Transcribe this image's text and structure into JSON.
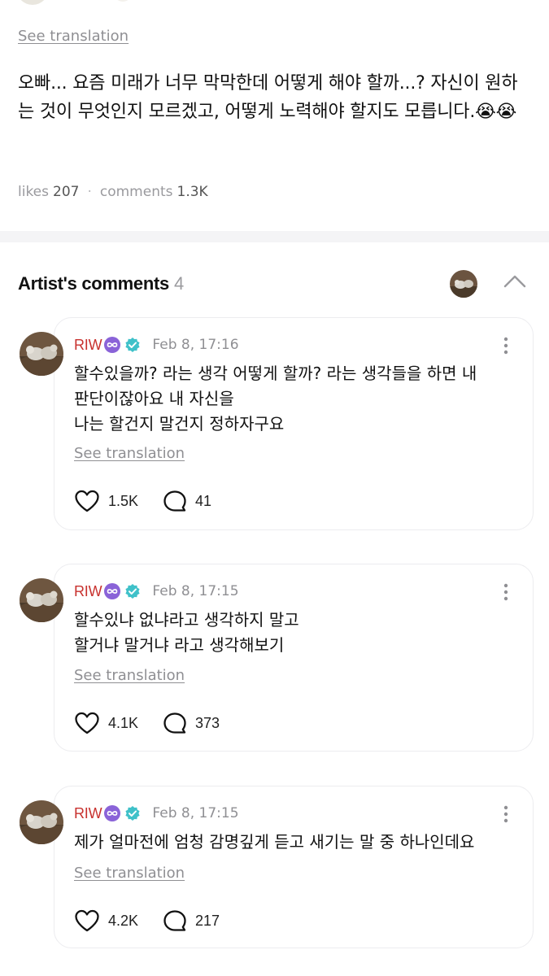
{
  "post": {
    "see_translation": "See translation",
    "body": "오빠... 요즘 미래가 너무 막막한데 어떻게 해야 할까...? 자신이 원하는 것이 무엇인지 모르겠고, 어떻게 노력해야 할지도 모릅니다.😭😭",
    "likes_label": "likes",
    "likes": "207",
    "comments_label": "comments",
    "comments": "1.3K"
  },
  "artist_comments": {
    "title": "Artist's comments",
    "count": "4"
  },
  "comments": [
    {
      "name": "RIW",
      "time": "Feb 8, 17:16",
      "lines": [
        "할수있을까? 라는 생각 어떻게 할까? 라는 생각들을 하면 내",
        "판단이잖아요 내 자신을",
        "나는 할건지 말건지 정하자구요"
      ],
      "see_translation": "See translation",
      "likes": "1.5K",
      "replies": "41"
    },
    {
      "name": "RIW",
      "time": "Feb 8, 17:15",
      "lines": [
        "할수있냐 없냐라고 생각하지 말고",
        "할거냐 말거냐 라고 생각해보기"
      ],
      "see_translation": "See translation",
      "likes": "4.1K",
      "replies": "373"
    },
    {
      "name": "RIW",
      "time": "Feb 8, 17:15",
      "lines": [
        "제가 얼마전에 엄청 감명깊게 듣고 새기는 말 중 하나인데요"
      ],
      "see_translation": "See translation",
      "likes": "4.2K",
      "replies": "217"
    }
  ],
  "colors": {
    "name_red": "#c8322f",
    "infinity_purple": "#8a63d8",
    "verified_teal": "#3fc1c9",
    "muted": "#8f8f93"
  },
  "icons": [
    "infinity-badge-icon",
    "verified-icon",
    "heart-icon",
    "comment-bubble-icon",
    "more-vertical-icon",
    "chevron-up-icon"
  ]
}
